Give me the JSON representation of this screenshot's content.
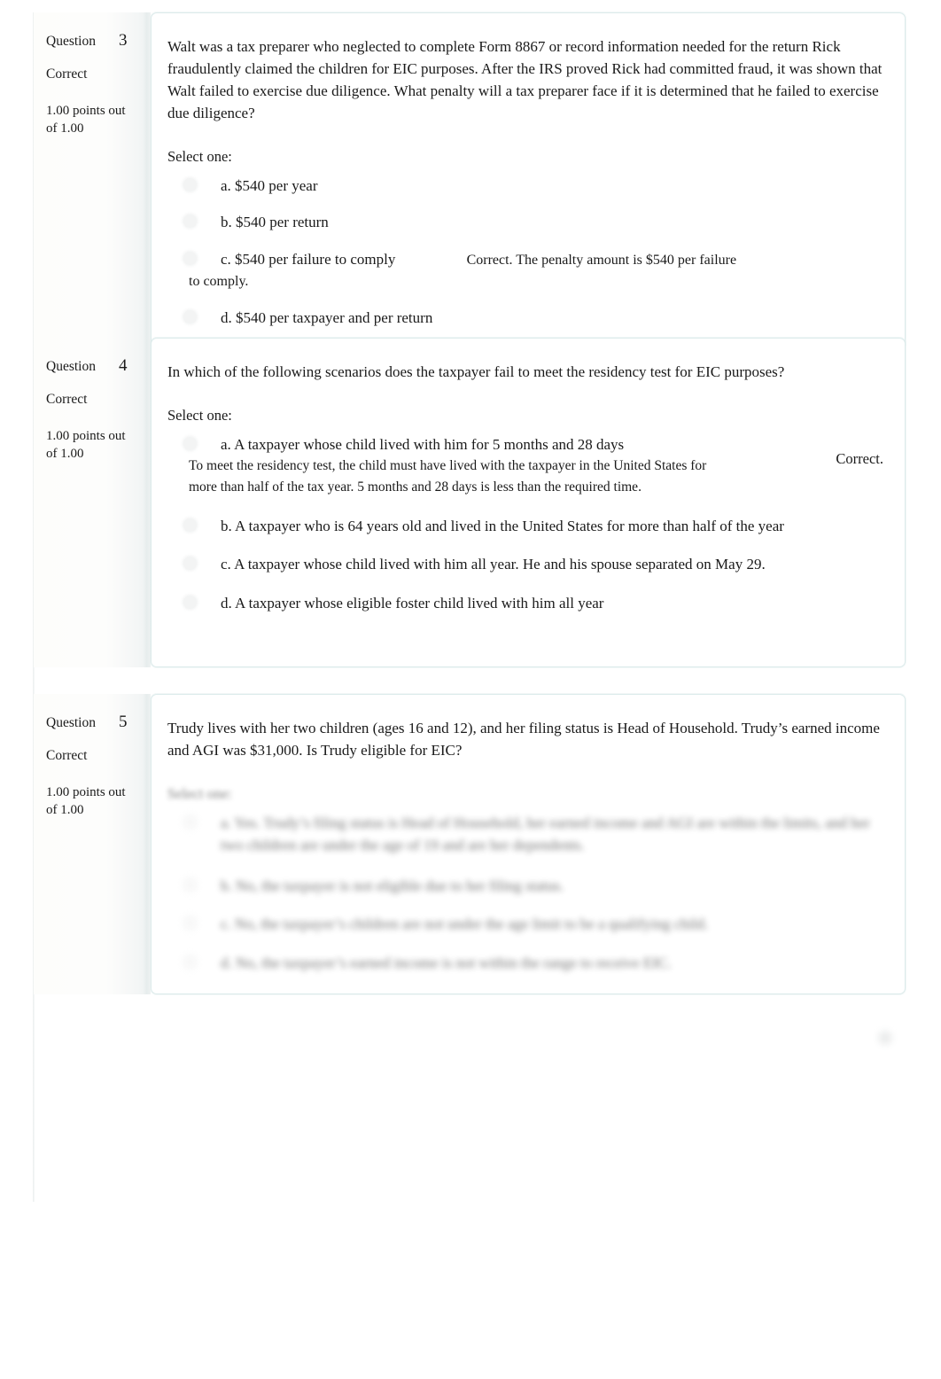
{
  "page": {
    "accent_border": "#dcebeb",
    "info_bg": "#f1f5f5"
  },
  "questions": [
    {
      "label": "Question",
      "number": "3",
      "state": "Correct",
      "grade": "1.00 points out of 1.00",
      "text": "Walt was a tax preparer who neglected to complete Form 8867 or record information needed for the return Rick fraudulently claimed the children for EIC purposes. After the IRS proved Rick had committed fraud, it was shown that Walt failed to exercise due diligence. What penalty will a tax preparer face if it is determined that he failed to exercise due diligence?",
      "prompt": "Select one:",
      "answers": [
        {
          "text": "a. $540 per year",
          "feedback": "",
          "feedback_trailing": ""
        },
        {
          "text": "b. $540 per return",
          "feedback": "",
          "feedback_trailing": ""
        },
        {
          "text": "c. $540 per failure to comply",
          "feedback": "Correct. The penalty amount is $540 per failure",
          "feedback_trailing": "to comply."
        },
        {
          "text": "d. $540 per taxpayer and per return",
          "feedback": "",
          "feedback_trailing": ""
        }
      ],
      "overall_feedback": ""
    },
    {
      "label": "Question",
      "number": "4",
      "state": "Correct",
      "grade": "1.00 points out of 1.00",
      "text": "In which of the following scenarios does the taxpayer fail to meet the residency test for EIC purposes?",
      "prompt": "Select one:",
      "answers": [
        {
          "text": "a. A taxpayer whose child lived with him for 5 months and 28 days",
          "specific_feedback": "To meet the residency test, the child must have lived with the taxpayer in the United States for more than half of the tax year. 5 months and 28 days is less than the required time."
        },
        {
          "text": "b. A taxpayer who is 64 years old and lived in the United States for more than half of the year"
        },
        {
          "text": "c. A taxpayer whose child lived with him all year. He and his spouse separated on May 29."
        },
        {
          "text": "d. A taxpayer whose eligible foster child lived with him all year"
        }
      ],
      "overall_feedback": "Correct."
    },
    {
      "label": "Question",
      "number": "5",
      "state": "Correct",
      "grade": "1.00 points out of 1.00",
      "text": "Trudy lives with her two children (ages 16 and 12), and her filing status is Head of Household. Trudy’s earned income and AGI was $31,000. Is Trudy eligible for EIC?",
      "prompt": "Select one:",
      "redacted": true,
      "answers": [
        {
          "text": "a. Yes. Trudy’s filing status is Head of Household, her earned income and AGI are within the limits, and her two children are under the age of 19 and are her dependents."
        },
        {
          "text": "b. No, the taxpayer is not eligible due to her filing status."
        },
        {
          "text": "c. No, the taxpayer’s children are not under the age limit to be a qualifying child."
        },
        {
          "text": "d. No, the taxpayer’s earned income is not within the range to receive EIC."
        }
      ],
      "overall_feedback": ""
    }
  ]
}
